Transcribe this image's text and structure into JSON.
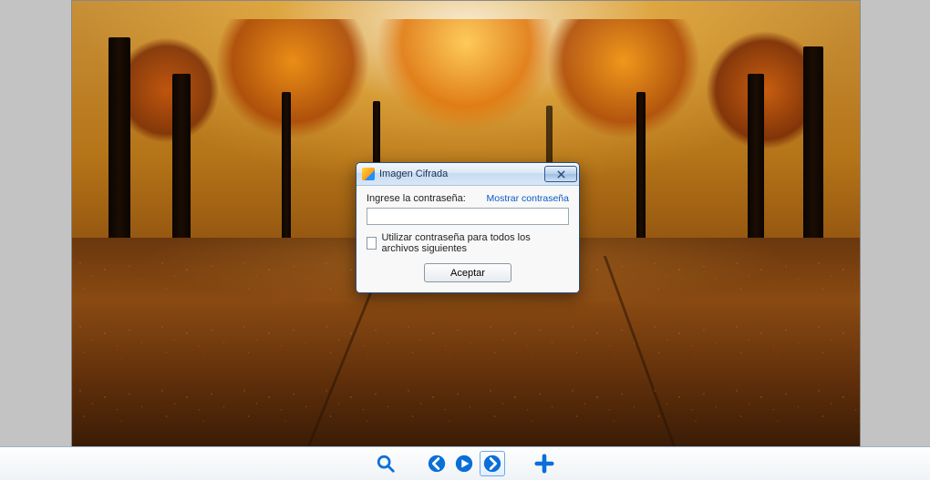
{
  "dialog": {
    "title": "Imagen Cifrada",
    "prompt_label": "Ingrese la contraseña:",
    "show_password_link": "Mostrar contraseña",
    "password_value": "",
    "remember_checkbox_label": "Utilizar contraseña para todos los archivos siguientes",
    "accept_button": "Aceptar"
  },
  "toolbar": {
    "zoom_icon": "magnifier-icon",
    "prev_icon": "chevron-left-circle-icon",
    "play_icon": "play-circle-icon",
    "next_icon": "chevron-right-circle-icon",
    "add_icon": "plus-icon"
  }
}
